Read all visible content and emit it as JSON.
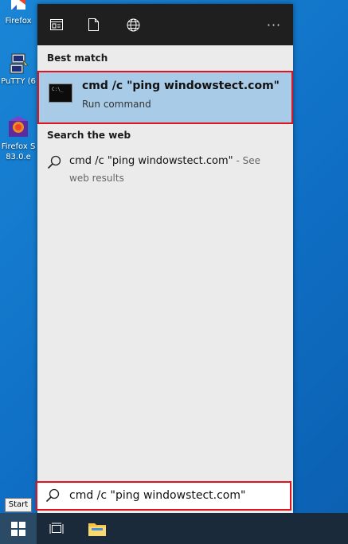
{
  "desktop": {
    "icons": [
      {
        "name": "firefox-top",
        "label": "Firefox"
      },
      {
        "name": "putty",
        "label": "PuTTY (6"
      },
      {
        "name": "firefox-setup",
        "label_line1": "Firefox S",
        "label_line2": "83.0.e"
      }
    ]
  },
  "panel": {
    "toolbar_icons": [
      "apps-icon",
      "document-icon",
      "globe-icon",
      "more-icon"
    ],
    "more_label": "···",
    "best_match_heading": "Best match",
    "best_match": {
      "title": "cmd /c \"ping windowstect.com\"",
      "subtitle": "Run command"
    },
    "search_web_heading": "Search the web",
    "web_result": {
      "query": "cmd /c \"ping windowstect.com\"",
      "suffix": " - See",
      "line2": "web results"
    },
    "search_box": {
      "value": "cmd /c \"ping windowstect.com\""
    }
  },
  "tooltip": {
    "label": "Start"
  },
  "colors": {
    "accent_highlight": "#a8cbe8",
    "annotation_red": "#e0141e",
    "taskbar": "#1b2a3a"
  }
}
